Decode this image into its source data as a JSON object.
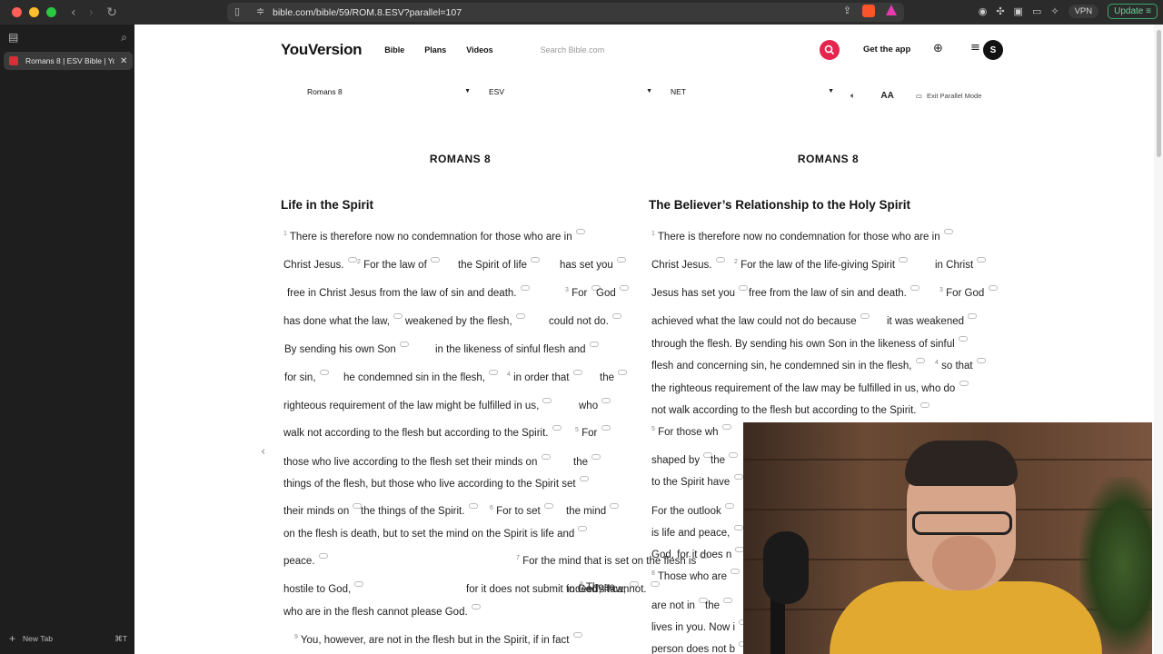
{
  "browser": {
    "url": "bible.com/bible/59/ROM.8.ESV?parallel=107",
    "vpn_label": "VPN",
    "update_label": "Update",
    "tab_title": "Romans 8 | ESV Bible | Yo",
    "new_tab_label": "New Tab",
    "new_tab_shortcut": "⌘T"
  },
  "site": {
    "logo": "YouVersion",
    "nav": [
      "Bible",
      "Plans",
      "Videos"
    ],
    "search_placeholder": "Search Bible.com",
    "get_app": "Get the app",
    "avatar_letter": "S",
    "accent_color": "#e5254d"
  },
  "selectors": {
    "book_chapter": "Romans 8",
    "version_left": "ESV",
    "version_right": "NET",
    "text_size_label": "AA",
    "exit_parallel": "Exit Parallel Mode"
  },
  "left": {
    "chapter": "ROMANS 8",
    "section_title": "Life in the Spirit"
  },
  "right": {
    "chapter": "ROMANS 8",
    "section_title": "The Believer’s Relationship to the Holy Spirit"
  },
  "left_lines": [
    [
      "1",
      "There is therefore now no condemnation for those who are in"
    ],
    [
      "",
      "Christ Jesus."
    ],
    [
      "2",
      "For the law of"
    ],
    [
      "",
      "the Spirit of life"
    ],
    [
      "",
      "has set you"
    ],
    [
      "",
      "free in Christ Jesus from the law of sin and death."
    ],
    [
      "3",
      "For"
    ],
    [
      "",
      "God"
    ],
    [
      "",
      "has done what the law,"
    ],
    [
      "",
      "weakened by the flesh,"
    ],
    [
      "",
      "could not do."
    ],
    [
      "",
      "By sending his own Son"
    ],
    [
      "",
      "in the likeness of sinful flesh and"
    ],
    [
      "",
      "for sin,"
    ],
    [
      "",
      "he condemned sin in the flesh,"
    ],
    [
      "4",
      "in order that"
    ],
    [
      "",
      "the"
    ],
    [
      "",
      "righteous requirement of the law might be fulfilled in us,"
    ],
    [
      "",
      "who"
    ],
    [
      "",
      "walk not according to the flesh but according to the Spirit."
    ],
    [
      "5",
      "For"
    ],
    [
      "",
      "those who live according to the flesh set their minds on"
    ],
    [
      "",
      "the"
    ],
    [
      "",
      "things of the flesh, but those who live according to the Spirit set"
    ],
    [
      "",
      "their minds on"
    ],
    [
      "",
      "the things of the Spirit."
    ],
    [
      "6",
      "For to set"
    ],
    [
      "",
      "the mind"
    ],
    [
      "",
      "on the flesh is death, but to set the mind on the Spirit is life and"
    ],
    [
      "",
      "peace."
    ],
    [
      "7",
      "For the mind that is set on the flesh is"
    ],
    [
      "",
      "hostile to God,"
    ],
    [
      "",
      "for it does not submit to God’s law;"
    ],
    [
      "",
      "indeed, it cannot."
    ],
    [
      "8",
      "Those"
    ],
    [
      "",
      "who are in the flesh cannot please God."
    ],
    [
      "9",
      "You, however, are not in the flesh but in the Spirit, if in fact"
    ]
  ],
  "right_lines": [
    [
      "1",
      "There is therefore now no condemnation for those who are in"
    ],
    [
      "",
      "Christ Jesus."
    ],
    [
      "2",
      "For the law of the life-giving Spirit"
    ],
    [
      "",
      "in Christ"
    ],
    [
      "",
      "Jesus has set you"
    ],
    [
      "",
      "free from the law of sin and death."
    ],
    [
      "3",
      "For God"
    ],
    [
      "",
      "achieved what the law could not do because"
    ],
    [
      "",
      "it was weakened"
    ],
    [
      "",
      "through the flesh. By sending his own Son in the likeness of sinful"
    ],
    [
      "",
      "flesh and concerning sin, he condemned sin in the flesh,"
    ],
    [
      "4",
      "so that"
    ],
    [
      "",
      "the righteous requirement of the law may be fulfilled in us, who do"
    ],
    [
      "",
      "not walk according to the flesh but according to the Spirit."
    ],
    [
      "5",
      "For those wh"
    ],
    [
      "",
      "shaped by"
    ],
    [
      "",
      "the"
    ],
    [
      "",
      "to the Spirit have"
    ],
    [
      "",
      "For the outlook"
    ],
    [
      "",
      "is life and peace,"
    ],
    [
      "",
      "God, for it does n"
    ],
    [
      "8",
      "Those who are"
    ],
    [
      "",
      "are not in"
    ],
    [
      "",
      "the"
    ],
    [
      "",
      "lives in you. Now i"
    ],
    [
      "",
      "person does not b"
    ]
  ]
}
